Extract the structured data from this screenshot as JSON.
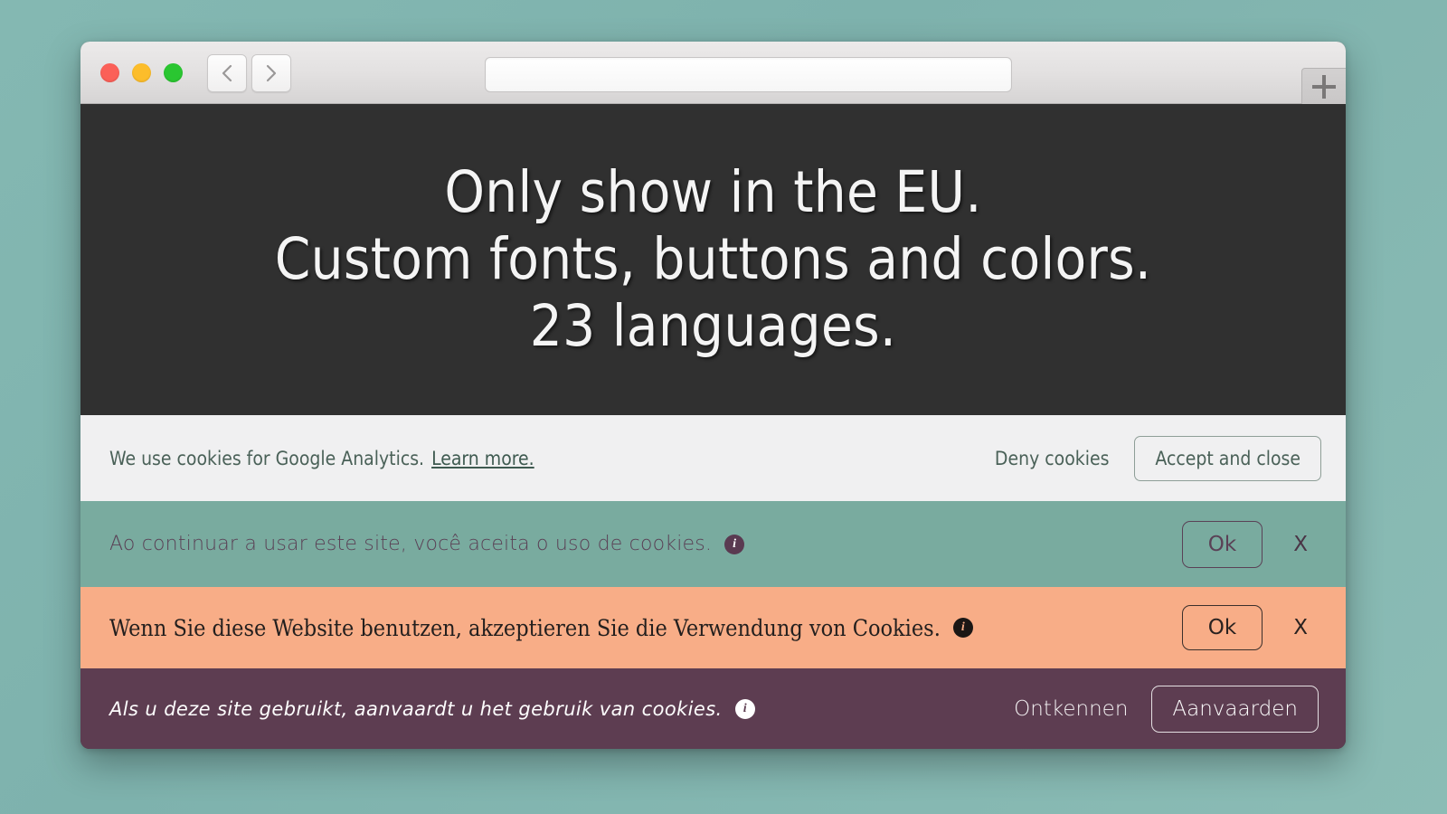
{
  "desktop": {
    "background_color": "#81b5b0"
  },
  "browser": {
    "window_controls": [
      {
        "name": "close",
        "color": "#fb6058"
      },
      {
        "name": "minimize",
        "color": "#fcbd2b"
      },
      {
        "name": "maximize",
        "color": "#2ac631"
      }
    ],
    "back_button_icon": "chevron-left-icon",
    "forward_button_icon": "chevron-right-icon",
    "url_bar": {
      "value": "",
      "placeholder": ""
    },
    "new_tab_label": "+"
  },
  "hero": {
    "line1": "Only show in the EU.",
    "line2": "Custom fonts, buttons and colors.",
    "line3": "23 languages.",
    "background_color": "#303030",
    "text_color": "#f4f4f4"
  },
  "banners": [
    {
      "id": "analytics",
      "background_color": "#f0f0f1",
      "text_color": "#4a6158",
      "message": "We use cookies for Google Analytics.",
      "link_label": "Learn more.",
      "deny_label": "Deny cookies",
      "accept_label": "Accept and close"
    },
    {
      "id": "pt",
      "language": "Portuguese",
      "background_color": "#79ab9f",
      "text_color": "#5a4156",
      "message": "Ao continuar a usar este site, você aceita o uso de cookies.",
      "info_icon": "info-icon",
      "accept_label": "Ok",
      "close_label": "X"
    },
    {
      "id": "de",
      "language": "German",
      "background_color": "#f8ad87",
      "text_color": "#231f1e",
      "message": "Wenn Sie diese Website benutzen, akzeptieren Sie die Verwendung von Cookies.",
      "info_icon": "info-icon",
      "accept_label": "Ok",
      "close_label": "X"
    },
    {
      "id": "nl",
      "language": "Dutch",
      "background_color": "#5d3d51",
      "text_color": "#fdfdfd",
      "message": "Als u deze site gebruikt, aanvaardt u het gebruik van cookies.",
      "info_icon": "info-icon",
      "deny_label": "Ontkennen",
      "accept_label": "Aanvaarden"
    }
  ],
  "icons": {
    "info_glyph": "i",
    "plus_glyph": "+"
  }
}
